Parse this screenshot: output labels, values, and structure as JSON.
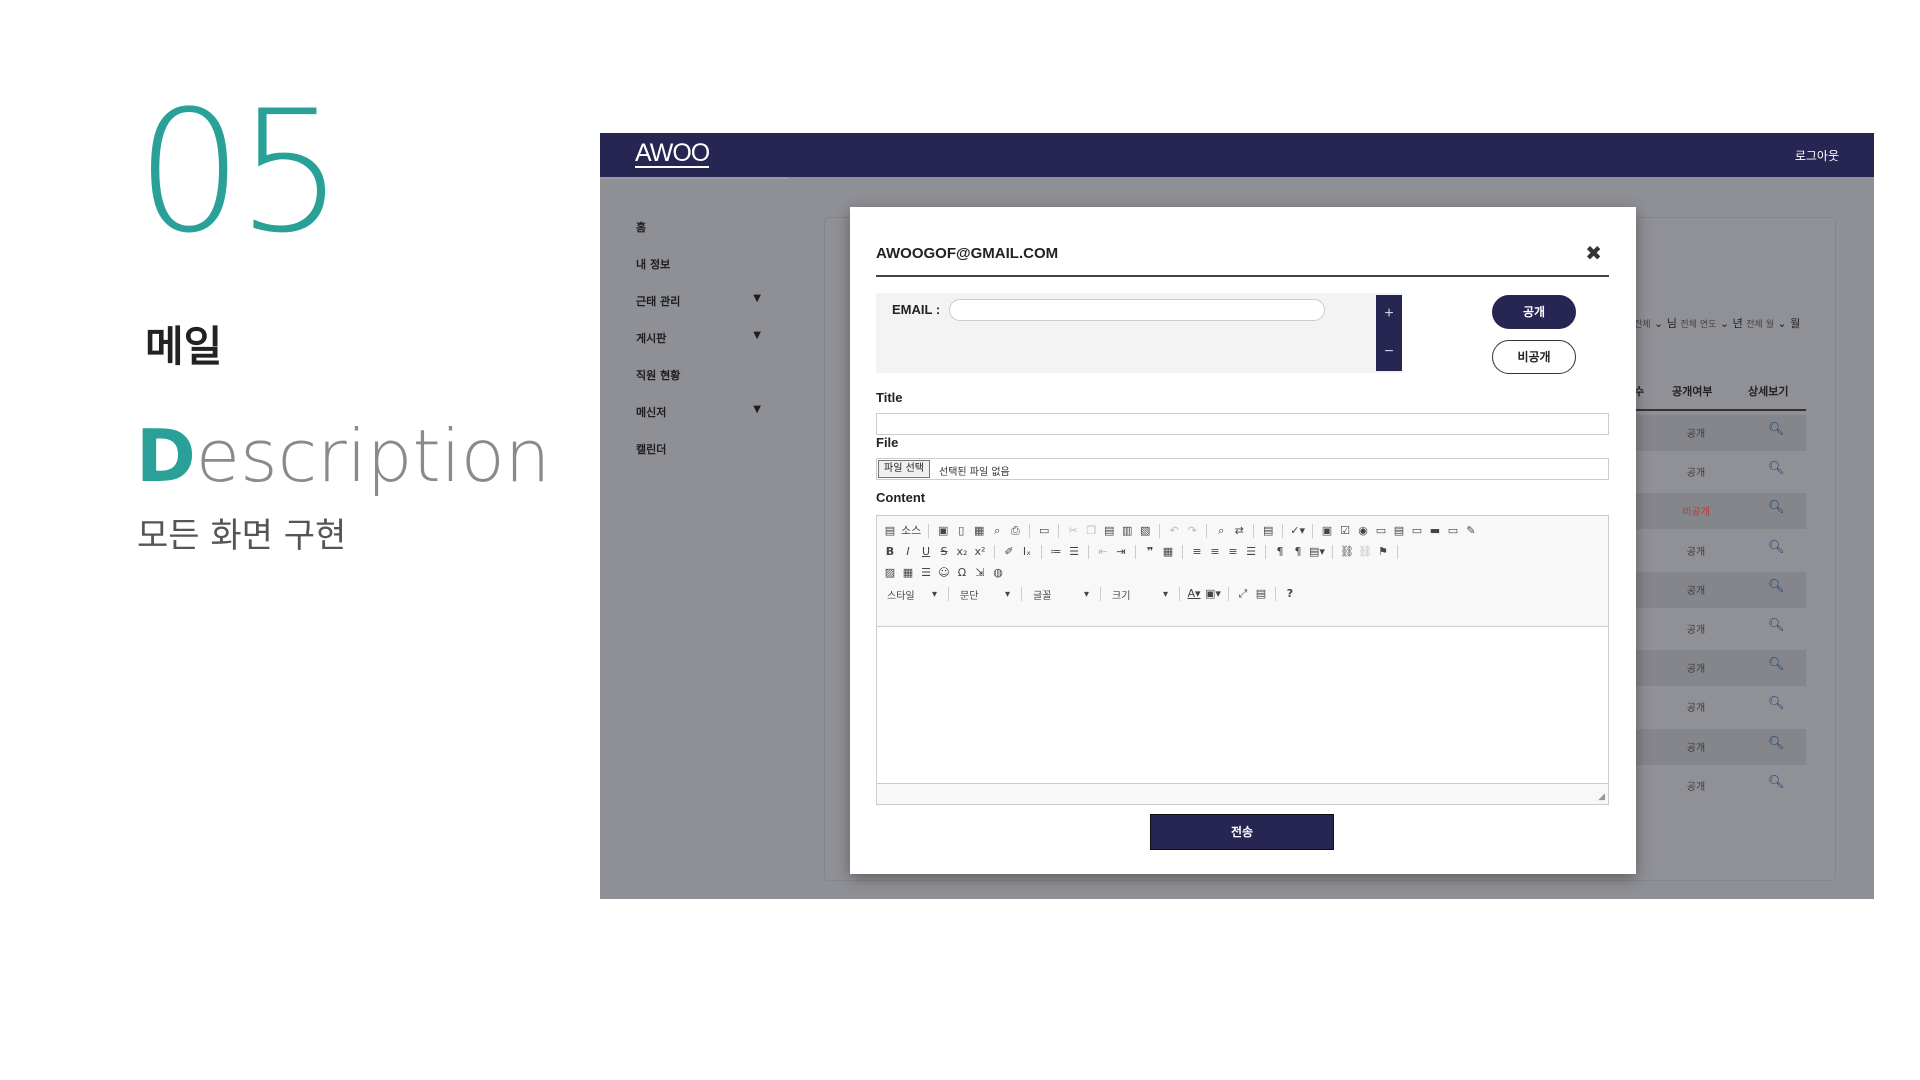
{
  "slide": {
    "number": "05",
    "title": "메일",
    "description_first_letter": "D",
    "description_rest": "escription",
    "subtitle": "모든 화면 구현"
  },
  "app": {
    "logo": "AWOO",
    "logout": "로그아웃",
    "sidebar": [
      {
        "label": "홈",
        "caret": ""
      },
      {
        "label": "내 정보",
        "caret": ""
      },
      {
        "label": "근태 관리",
        "caret": "▼"
      },
      {
        "label": "게시판",
        "caret": "▼"
      },
      {
        "label": "직원 현황",
        "caret": ""
      },
      {
        "label": "메신저",
        "caret": "▼"
      },
      {
        "label": "캘린더",
        "caret": ""
      }
    ],
    "background_table": {
      "filter": {
        "a_small": "전체",
        "a_unit": "님",
        "b_small": "전체 연도",
        "b_unit": "년",
        "c_small": "전체 월",
        "c_unit": "월"
      },
      "headers": [
        "수",
        "공개여부",
        "상세보기"
      ],
      "rows": [
        "공개",
        "공개",
        "비공개",
        "공개",
        "공개",
        "공개",
        "공개",
        "공개",
        "공개",
        "공개"
      ]
    },
    "modal": {
      "title": "AWOOGOF@GMAIL.COM",
      "close": "✖",
      "email_label": "EMAIL :",
      "email_value": "",
      "plus": "+",
      "minus": "−",
      "public_button": "공개",
      "private_button": "비공개",
      "title_label": "Title",
      "title_value": "",
      "file_label": "File",
      "file_button": "파일 선택",
      "file_status": "선택된 파일 없음",
      "content_label": "Content",
      "editor": {
        "source_label": "소스",
        "style_combo": "스타일",
        "paragraph_combo": "문단",
        "font_combo": "글꼴",
        "size_combo": "크기"
      },
      "send_button": "전송"
    }
  }
}
